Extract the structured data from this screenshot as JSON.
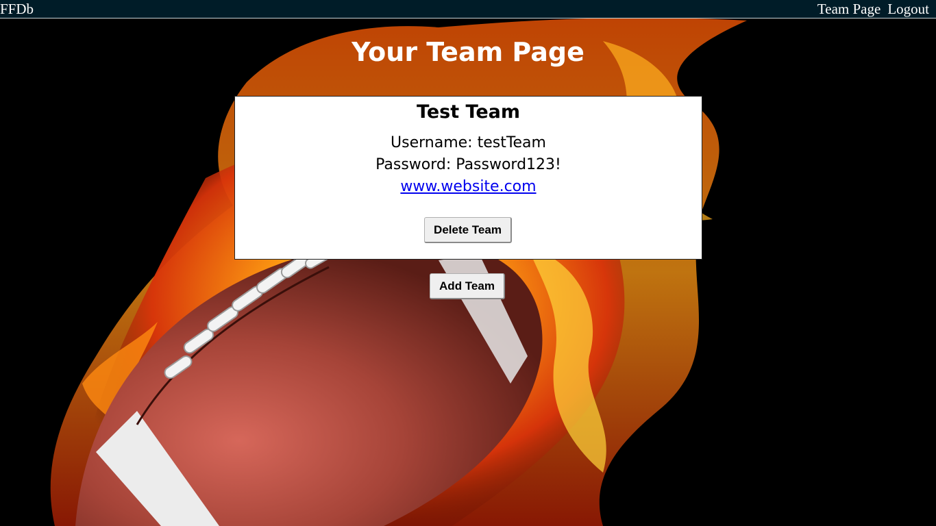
{
  "navbar": {
    "brand": "FFDb",
    "links": [
      "Team Page",
      "Logout"
    ]
  },
  "page": {
    "title": "Your Team Page"
  },
  "team": {
    "name": "Test Team",
    "username_line": "Username: testTeam",
    "password_line": "Password: Password123!",
    "website": "www.website.com",
    "delete_label": "Delete Team"
  },
  "actions": {
    "add_label": "Add Team"
  },
  "background": {
    "image": "flaming-football-icon",
    "colors": {
      "fire_orange": "#ff7a10",
      "fire_yellow": "#ffd21a",
      "ball_brown": "#a6463a",
      "stripe_white": "#efefef"
    }
  },
  "colors": {
    "navbar_bg": "#001c28",
    "link": "#0000ee",
    "card_bg": "#ffffff"
  }
}
